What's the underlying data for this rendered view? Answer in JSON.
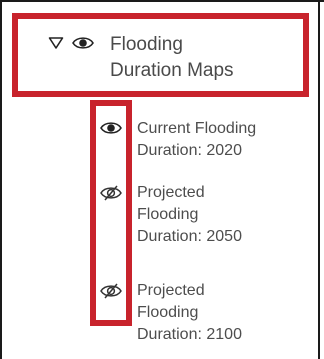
{
  "layer_list": {
    "group": {
      "title_line1": "Flooding",
      "title_line2": "Duration Maps",
      "caret_icon": "caret-down-outline",
      "visibility_icon": "eye-open",
      "expanded": true
    },
    "layers": [
      {
        "label_line1": "Current Flooding",
        "label_line2": "Duration: 2020",
        "label_line3": "",
        "visibility_icon": "eye-open",
        "visible": true
      },
      {
        "label_line1": "Projected",
        "label_line2": "Flooding",
        "label_line3": "Duration: 2050",
        "visibility_icon": "eye-slashed",
        "visible": false
      },
      {
        "label_line1": "Projected",
        "label_line2": "Flooding",
        "label_line3": "Duration: 2100",
        "visibility_icon": "eye-slashed",
        "visible": false
      }
    ]
  },
  "highlight_color": "#c8232c"
}
